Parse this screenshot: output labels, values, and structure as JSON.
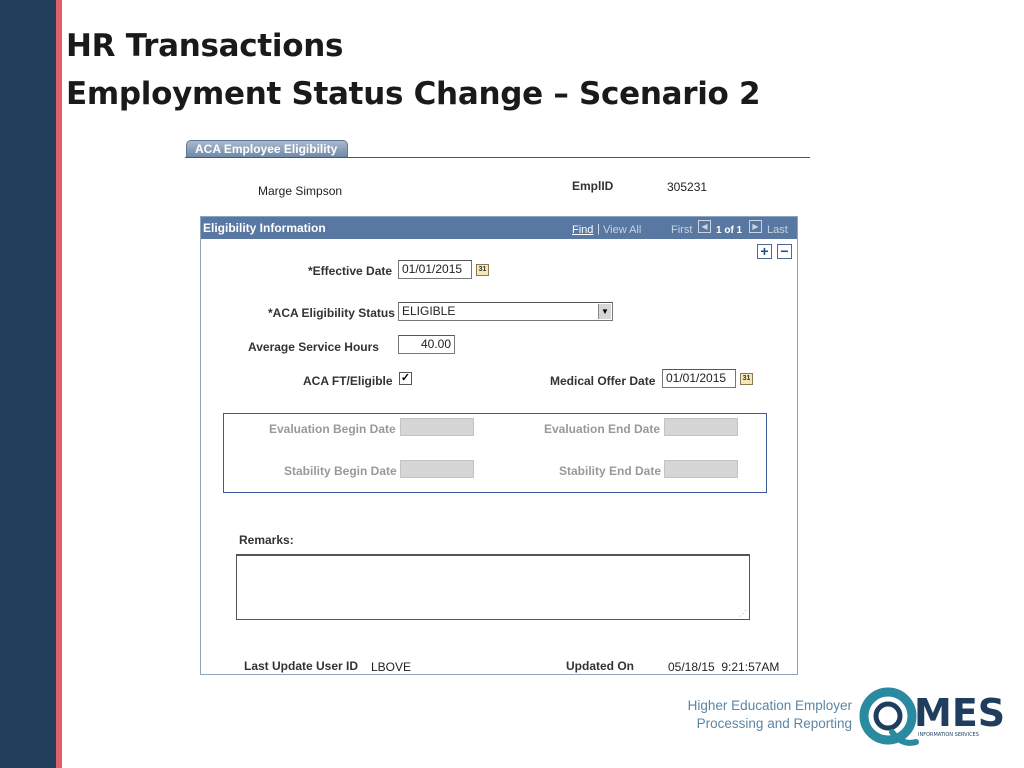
{
  "slide": {
    "title_line1": "HR Transactions",
    "title_line2": "Employment Status Change – Scenario 2",
    "footer_line1": "Higher Education Employer",
    "footer_line2": "Processing and Reporting",
    "logo_text": "MES",
    "logo_subtext": "INFORMATION SERVICES"
  },
  "page": {
    "tab_label": "ACA Employee Eligibility",
    "employee_name": "Marge Simpson",
    "emplid_label": "EmplID",
    "emplid_value": "305231"
  },
  "panel": {
    "title": "Eligibility Information",
    "find_link": "Find",
    "separator": "|",
    "view_all_link": "View All",
    "first_label": "First",
    "row_count": "1 of 1",
    "last_label": "Last",
    "add_row_symbol": "+",
    "delete_row_symbol": "−"
  },
  "form": {
    "effective_date_label": "*Effective Date",
    "effective_date_value": "01/01/2015",
    "aca_status_label": "*ACA Eligibility Status",
    "aca_status_value": "ELIGIBLE",
    "avg_hours_label": "Average Service Hours",
    "avg_hours_value": "40.00",
    "ft_eligible_label": "ACA FT/Eligible",
    "ft_eligible_checked": true,
    "medical_offer_label": "Medical Offer Date",
    "medical_offer_value": "01/01/2015",
    "eval_begin_label": "Evaluation Begin Date",
    "eval_end_label": "Evaluation End Date",
    "stability_begin_label": "Stability Begin Date",
    "stability_end_label": "Stability End Date",
    "remarks_label": "Remarks:",
    "remarks_value": "",
    "last_update_label": "Last Update User ID",
    "last_update_value": "LBOVE",
    "updated_on_label": "Updated On",
    "updated_on_value": "05/18/15  9:21:57AM"
  },
  "icons": {
    "calendar": "calendar-icon",
    "dropdown": "chevron-down-icon",
    "checkmark": "checkmark-icon",
    "prev": "arrow-left-icon",
    "next": "arrow-right-icon"
  },
  "colors": {
    "sidebar": "#233e5c",
    "stripe": "#e0606a",
    "panel_header": "#5877a1",
    "footer_text": "#5b86a6",
    "logo_teal": "#2a8aa0",
    "logo_navy": "#1f3d5c"
  }
}
